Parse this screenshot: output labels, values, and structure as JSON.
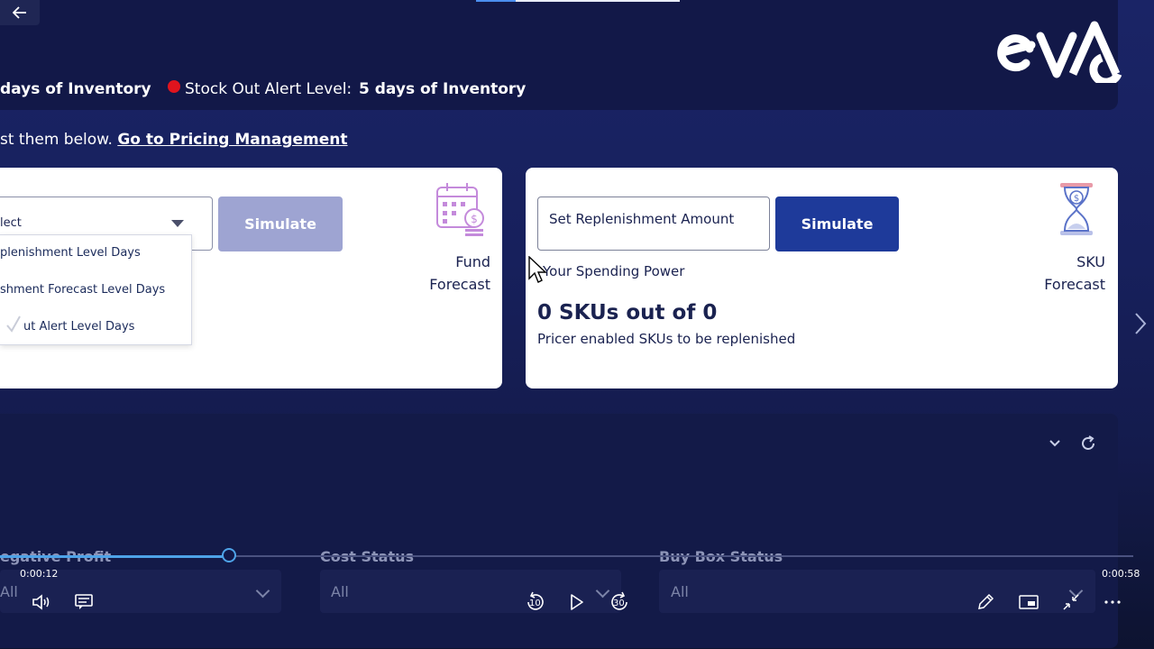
{
  "header": {
    "inventory_tail": "days of Inventory",
    "stock_out_label": "Stock Out Alert Level:",
    "stock_out_value": "5 days of Inventory",
    "logo_text": "eva"
  },
  "hint": {
    "text": "st them below.",
    "link": "Go to Pricing Management"
  },
  "fund_card": {
    "select_value": "lect",
    "dropdown_items": [
      "plenishment Level Days",
      "shment Forecast Level Days",
      "ut Alert Level Days"
    ],
    "simulate_label": "Simulate",
    "icon_label_1": "Fund",
    "icon_label_2": "Forecast"
  },
  "sku_card": {
    "input_placeholder": "Set Replenishment Amount",
    "simulate_label": "Simulate",
    "spending_power": "Your Spending Power",
    "sku_count": "0 SKUs out of 0",
    "sku_sub": "Pricer enabled SKUs to be replenished",
    "icon_label_1": "SKU",
    "icon_label_2": "Forecast"
  },
  "filters": [
    {
      "label": "egative Profit",
      "value": "All"
    },
    {
      "label": "Cost Status",
      "value": "All"
    },
    {
      "label": "Buy Box Status",
      "value": "All"
    }
  ],
  "player": {
    "elapsed": "0:00:12",
    "total": "0:00:58",
    "progress": 0.2,
    "skip_back": "10",
    "skip_forward": "30"
  },
  "colors": {
    "accent": "#1e3a9a",
    "disabled": "#9ea4d2",
    "alert_red": "#e0141e",
    "seek": "#4ea3e8"
  }
}
